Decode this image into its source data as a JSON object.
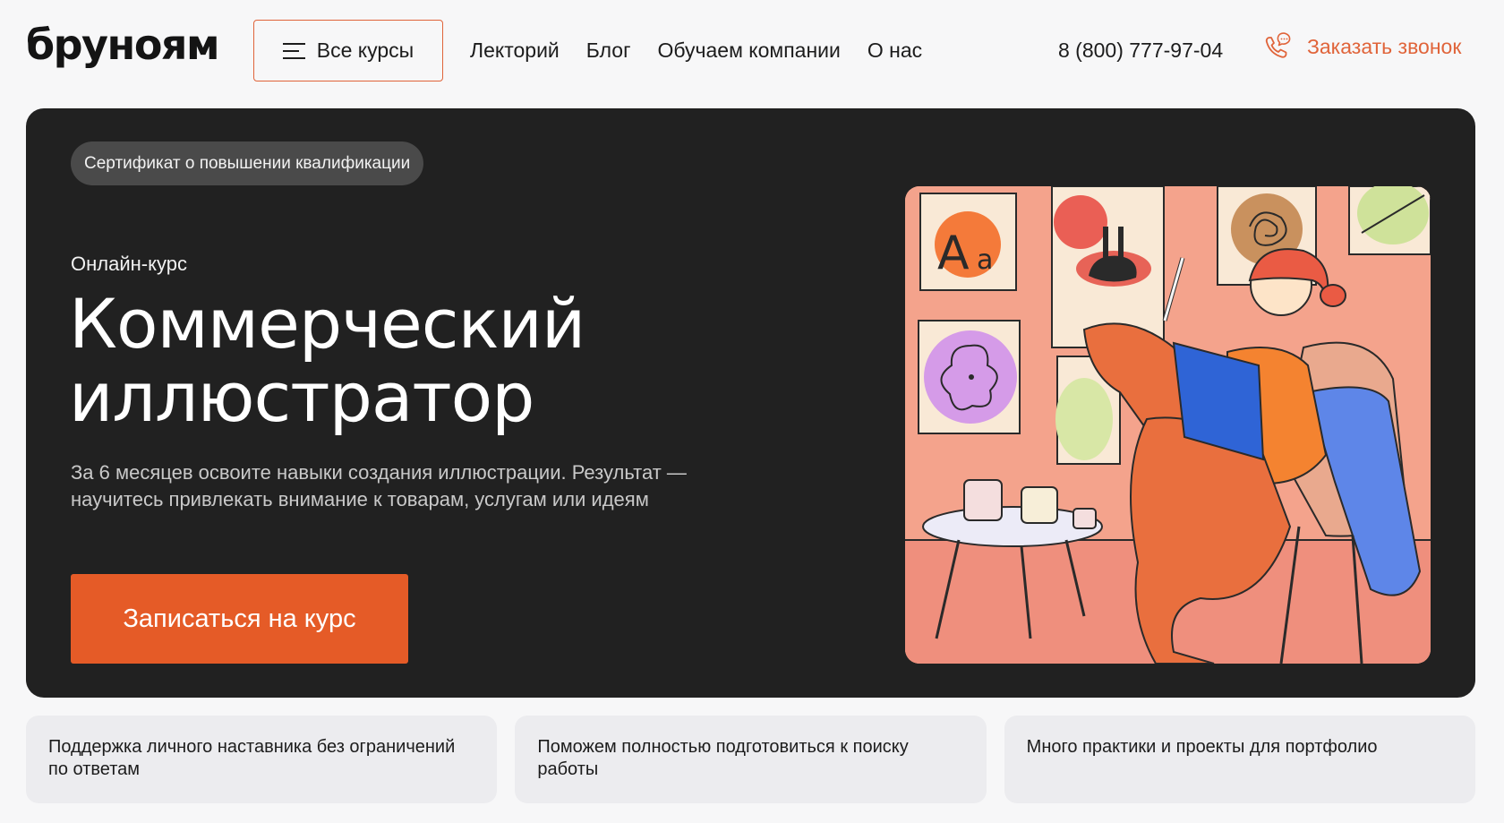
{
  "header": {
    "logo": "бруноям",
    "all_courses_label": "Все курсы",
    "nav": [
      {
        "label": "Лекторий"
      },
      {
        "label": "Блог"
      },
      {
        "label": "Обучаем компании"
      },
      {
        "label": "О нас"
      }
    ],
    "phone": "8 (800) 777-97-04",
    "callback_label": "Заказать звонок"
  },
  "hero": {
    "badge": "Сертификат о повышении квалификации",
    "eyebrow": "Онлайн-курс",
    "title": "Коммерческий иллюстратор",
    "description": "За 6 месяцев освоите навыки создания иллюстрации. Результат — научитесь привлекать внимание к товарам, услугам или идеям",
    "cta_label": "Записаться на курс",
    "illustration_icon": "illustrator-drawing-on-tablet-illustration"
  },
  "features": [
    {
      "text": "Поддержка личного наставника без ограничений по ответам"
    },
    {
      "text": "Поможем полностью подготовиться к поиску работы"
    },
    {
      "text": "Много практики и проекты для портфолио"
    }
  ],
  "colors": {
    "accent": "#e55b27",
    "hero_bg": "#212121",
    "page_bg": "#f7f7f8",
    "card_bg": "#ececef"
  },
  "icons": {
    "menu": "menu-icon",
    "callback": "phone-chat-icon"
  }
}
